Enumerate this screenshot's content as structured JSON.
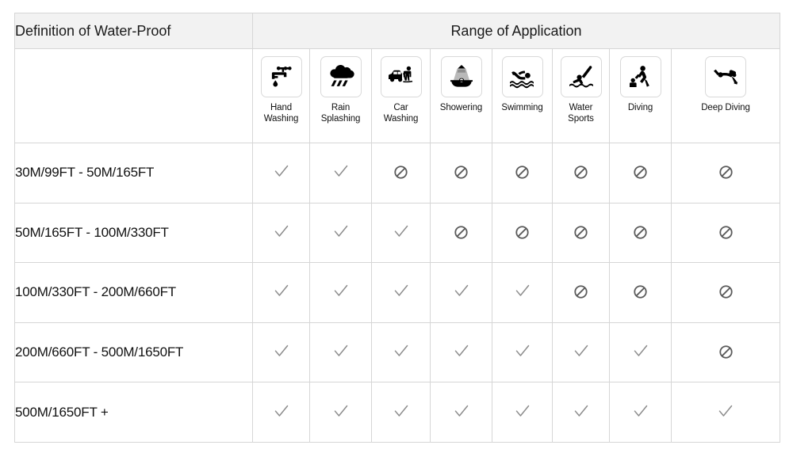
{
  "table": {
    "banner": {
      "definition_label": "Definition of Water-Proof",
      "range_label": "Range of Application"
    },
    "columns": [
      {
        "id": "hand-washing",
        "label": "Hand\nWashing",
        "icon": "faucet-icon"
      },
      {
        "id": "rain-splashing",
        "label": "Rain\nSplashing",
        "icon": "rain-cloud-icon"
      },
      {
        "id": "car-washing",
        "label": "Car\nWashing",
        "icon": "car-washing-icon"
      },
      {
        "id": "showering",
        "label": "Showering",
        "icon": "shower-icon"
      },
      {
        "id": "swimming",
        "label": "Swimming",
        "icon": "swimmer-icon"
      },
      {
        "id": "water-sports",
        "label": "Water\nSports",
        "icon": "water-skier-icon"
      },
      {
        "id": "diving",
        "label": "Diving",
        "icon": "diver-jump-icon"
      },
      {
        "id": "deep-diving",
        "label": "Deep Diving",
        "icon": "scuba-diver-icon"
      }
    ],
    "rows": [
      {
        "label": "30M/99FT  -  50M/165FT",
        "marks": [
          "check",
          "check",
          "ban",
          "ban",
          "ban",
          "ban",
          "ban",
          "ban"
        ]
      },
      {
        "label": "50M/165FT  -  100M/330FT",
        "marks": [
          "check",
          "check",
          "check",
          "ban",
          "ban",
          "ban",
          "ban",
          "ban"
        ]
      },
      {
        "label": "100M/330FT  -  200M/660FT",
        "marks": [
          "check",
          "check",
          "check",
          "check",
          "check",
          "ban",
          "ban",
          "ban"
        ]
      },
      {
        "label": "200M/660FT  -  500M/1650FT",
        "marks": [
          "check",
          "check",
          "check",
          "check",
          "check",
          "check",
          "check",
          "ban"
        ]
      },
      {
        "label": "500M/1650FT  +",
        "marks": [
          "check",
          "check",
          "check",
          "check",
          "check",
          "check",
          "check",
          "check"
        ]
      }
    ],
    "symbols": {
      "check": "check-mark-icon",
      "ban": "prohibition-icon"
    },
    "colors": {
      "banner_background": "#f2f2f2",
      "border": "#d6d6d6",
      "text": "#111111",
      "check_mark": "#8c8c8c",
      "prohibition": "#5a5a5a",
      "icon": "#000000"
    }
  }
}
